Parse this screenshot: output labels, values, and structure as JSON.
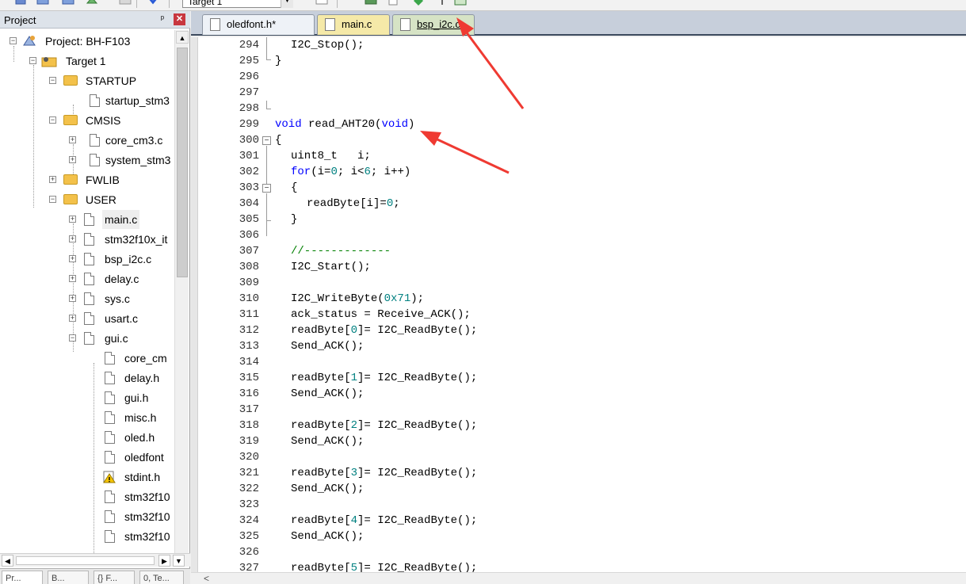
{
  "toolbar": {
    "target": "Target 1"
  },
  "project_panel": {
    "title": "Project",
    "pin_glyph": "ᵖ",
    "close_glyph": "✕",
    "bottom_tabs": [
      "Pr...",
      "B...",
      "{} F...",
      "0, Te..."
    ]
  },
  "tree": {
    "project": "Project: BH-F103",
    "target": "Target 1",
    "startup": {
      "name": "STARTUP",
      "file": "startup_stm3"
    },
    "cmsis": {
      "name": "CMSIS",
      "files": [
        "core_cm3.c",
        "system_stm3"
      ]
    },
    "fwlib": "FWLIB",
    "user": {
      "name": "USER",
      "files": [
        "main.c",
        "stm32f10x_it",
        "bsp_i2c.c",
        "delay.c",
        "sys.c",
        "usart.c",
        "gui.c"
      ]
    },
    "gui_children": [
      "core_cm",
      "delay.h",
      "gui.h",
      "misc.h",
      "oled.h",
      "oledfont",
      "stdint.h",
      "stm32f10",
      "stm32f10",
      "stm32f10"
    ]
  },
  "editor": {
    "tabs": [
      "oledfont.h*",
      "main.c",
      "bsp_i2c.c"
    ],
    "active_tab_index": 2,
    "line_numbers": [
      "294",
      "295",
      "296",
      "297",
      "298",
      "299",
      "300",
      "301",
      "302",
      "303",
      "304",
      "305",
      "306",
      "307",
      "308",
      "309",
      "310",
      "311",
      "312",
      "313",
      "314",
      "315",
      "316",
      "317",
      "318",
      "319",
      "320",
      "321",
      "322",
      "323",
      "324",
      "325",
      "326",
      "327"
    ],
    "lines": {
      "l294": "I2C_Stop();",
      "l295": "}",
      "l299_fn": " read_AHT20(",
      "l299_kw1": "void",
      "l299_kw2": "void",
      "l299_end": ")",
      "l300": "{",
      "l301": "uint8_t   i;",
      "l302_kw": "for",
      "l302_a": "(i=",
      "l302_n1": "0",
      "l302_b": "; i<",
      "l302_n2": "6",
      "l302_c": "; i++)",
      "l303": "{",
      "l304_a": "readByte[i]=",
      "l304_n": "0",
      "l304_b": ";",
      "l305": "}",
      "l307": "//-------------",
      "l308": "I2C_Start();",
      "l310_a": "I2C_WriteByte(",
      "l310_n": "0x71",
      "l310_b": ");",
      "l311": "ack_status = Receive_ACK();",
      "rb_pre": "readByte[",
      "rb_post": "]= I2C_ReadByte();",
      "idx0": "0",
      "idx1": "1",
      "idx2": "2",
      "idx3": "3",
      "idx4": "4",
      "idx5": "5",
      "send_ack": "Send_ACK();"
    }
  },
  "colors": {
    "arrow": "#ef3a32",
    "keyword": "#0000ff",
    "number": "#008080",
    "comment": "#008000"
  }
}
